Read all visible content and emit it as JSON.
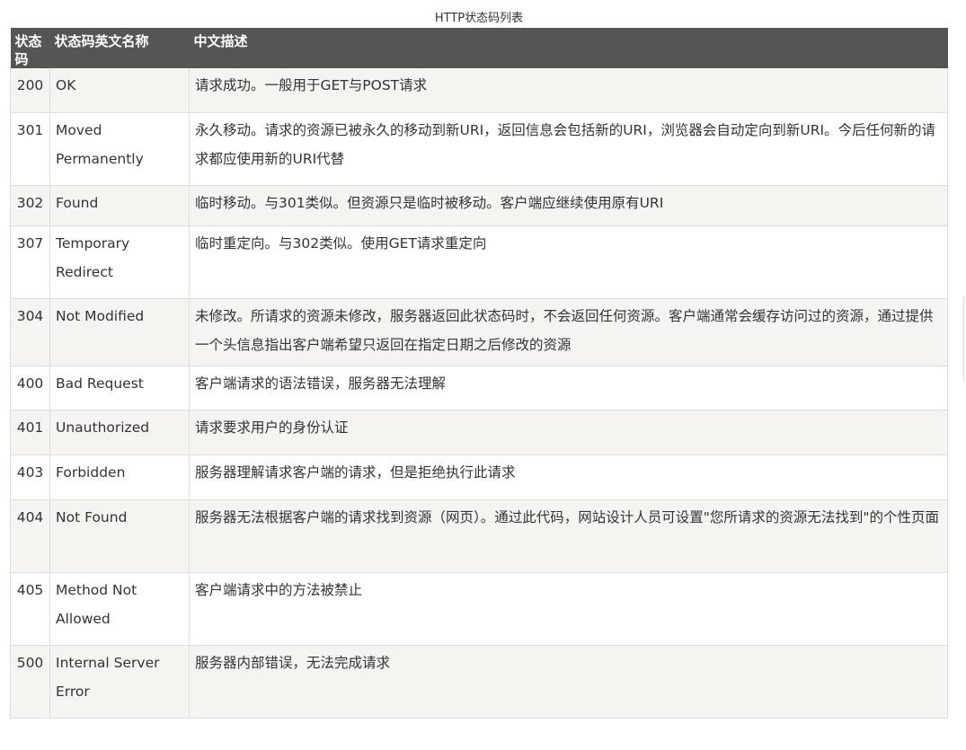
{
  "caption": "HTTP状态码列表",
  "headers": {
    "code": "状态码",
    "name": "状态码英文名称",
    "desc": "中文描述"
  },
  "rows": [
    {
      "code": "200",
      "name": "OK",
      "desc": "请求成功。一般用于GET与POST请求"
    },
    {
      "code": "301",
      "name": "Moved Permanently",
      "desc": "永久移动。请求的资源已被永久的移动到新URI，返回信息会包括新的URI，浏览器会自动定向到新URI。今后任何新的请求都应使用新的URI代替"
    },
    {
      "code": "302",
      "name": "Found",
      "desc": "临时移动。与301类似。但资源只是临时被移动。客户端应继续使用原有URI"
    },
    {
      "code": "307",
      "name": "Temporary Redirect",
      "desc": "临时重定向。与302类似。使用GET请求重定向"
    },
    {
      "code": "304",
      "name": "Not Modified",
      "desc": "未修改。所请求的资源未修改，服务器返回此状态码时，不会返回任何资源。客户端通常会缓存访问过的资源，通过提供一个头信息指出客户端希望只返回在指定日期之后修改的资源"
    },
    {
      "code": "400",
      "name": "Bad Request",
      "desc": "客户端请求的语法错误，服务器无法理解"
    },
    {
      "code": "401",
      "name": "Unauthorized",
      "desc": "请求要求用户的身份认证"
    },
    {
      "code": "403",
      "name": "Forbidden",
      "desc": "服务器理解请求客户端的请求，但是拒绝执行此请求"
    },
    {
      "code": "404",
      "name": "Not Found",
      "desc": "服务器无法根据客户端的请求找到资源（网页）。通过此代码，网站设计人员可设置\"您所请求的资源无法找到\"的个性页面"
    },
    {
      "code": "405",
      "name": "Method Not Allowed",
      "desc": "客户端请求中的方法被禁止"
    },
    {
      "code": "500",
      "name": "Internal Server Error",
      "desc": "服务器内部错误，无法完成请求"
    }
  ]
}
